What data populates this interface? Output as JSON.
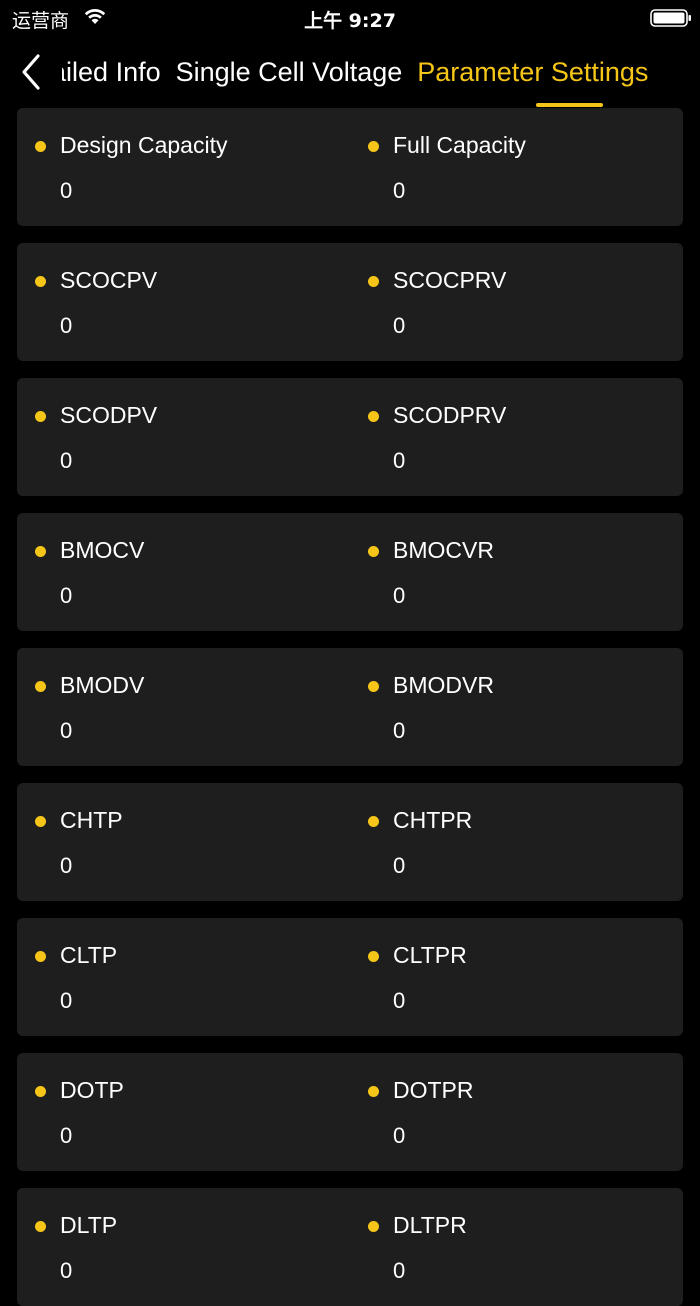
{
  "status_bar": {
    "carrier": "运营商",
    "time": "上午 9:27"
  },
  "nav": {
    "tabs": [
      {
        "label": "Detailed Info",
        "active": false
      },
      {
        "label": "Single Cell Voltage",
        "active": false
      },
      {
        "label": "Parameter Settings",
        "active": true
      }
    ]
  },
  "colors": {
    "accent": "#f5c518",
    "background": "#000000",
    "card": "#1e1e1e"
  },
  "cards": [
    {
      "left": {
        "label": "Design Capacity",
        "value": "0"
      },
      "right": {
        "label": "Full Capacity",
        "value": "0"
      }
    },
    {
      "left": {
        "label": "SCOCPV",
        "value": "0"
      },
      "right": {
        "label": "SCOCPRV",
        "value": "0"
      }
    },
    {
      "left": {
        "label": "SCODPV",
        "value": "0"
      },
      "right": {
        "label": "SCODPRV",
        "value": "0"
      }
    },
    {
      "left": {
        "label": "BMOCV",
        "value": "0"
      },
      "right": {
        "label": "BMOCVR",
        "value": "0"
      }
    },
    {
      "left": {
        "label": "BMODV",
        "value": "0"
      },
      "right": {
        "label": "BMODVR",
        "value": "0"
      }
    },
    {
      "left": {
        "label": "CHTP",
        "value": "0"
      },
      "right": {
        "label": "CHTPR",
        "value": "0"
      }
    },
    {
      "left": {
        "label": "CLTP",
        "value": "0"
      },
      "right": {
        "label": "CLTPR",
        "value": "0"
      }
    },
    {
      "left": {
        "label": "DOTP",
        "value": "0"
      },
      "right": {
        "label": "DOTPR",
        "value": "0"
      }
    },
    {
      "left": {
        "label": "DLTP",
        "value": "0"
      },
      "right": {
        "label": "DLTPR",
        "value": "0"
      }
    }
  ]
}
